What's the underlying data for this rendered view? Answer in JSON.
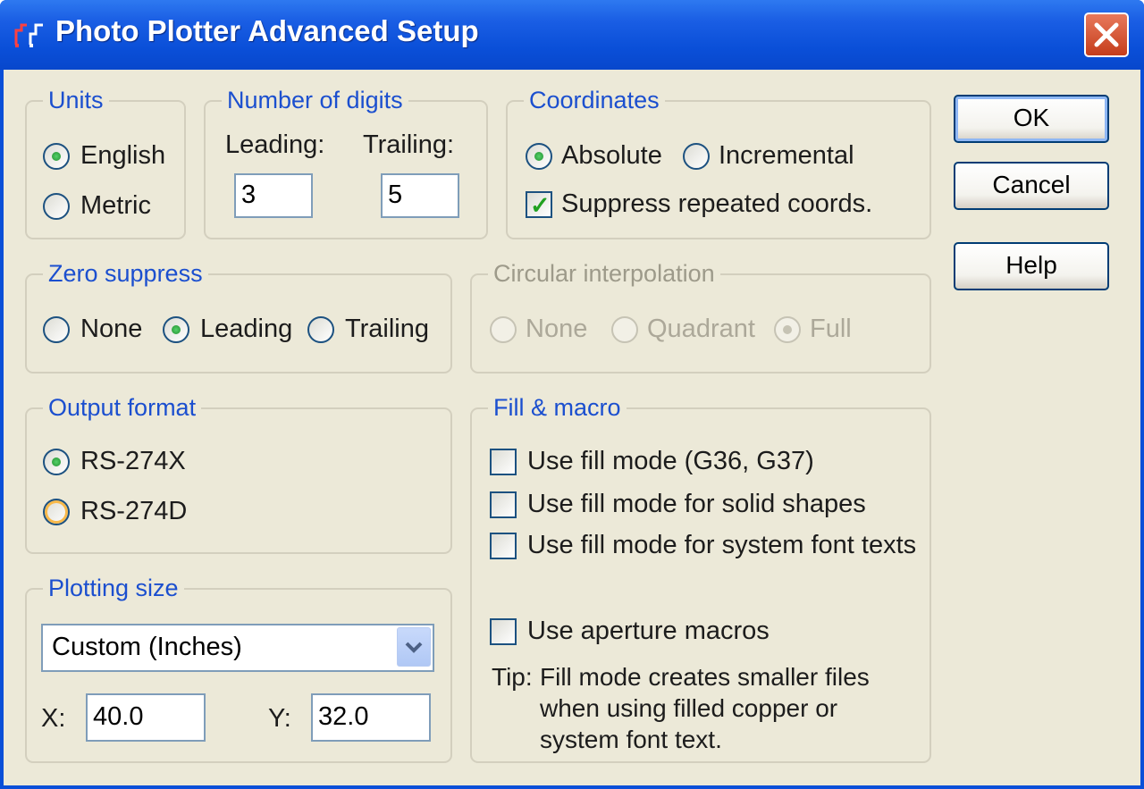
{
  "window": {
    "title": "Photo Plotter Advanced Setup"
  },
  "units": {
    "legend": "Units",
    "english": "English",
    "metric": "Metric",
    "selected": "English"
  },
  "digits": {
    "legend": "Number of digits",
    "leading_label": "Leading:",
    "trailing_label": "Trailing:",
    "leading_value": "3",
    "trailing_value": "5"
  },
  "coordinates": {
    "legend": "Coordinates",
    "absolute": "Absolute",
    "incremental": "Incremental",
    "selected": "Absolute",
    "suppress_label": "Suppress repeated coords.",
    "suppress_checked": true
  },
  "zero_suppress": {
    "legend": "Zero suppress",
    "none": "None",
    "leading": "Leading",
    "trailing": "Trailing",
    "selected": "Leading"
  },
  "circular": {
    "legend": "Circular interpolation",
    "none": "None",
    "quadrant": "Quadrant",
    "full": "Full",
    "selected": "Full",
    "enabled": false
  },
  "output_format": {
    "legend": "Output format",
    "rs274x": "RS-274X",
    "rs274d": "RS-274D",
    "selected": "RS-274X"
  },
  "fill_macro": {
    "legend": "Fill & macro",
    "use_fill": "Use fill mode (G36, G37)",
    "fill_solid": "Use fill mode for solid shapes",
    "fill_text": "Use fill mode for system font texts",
    "aperture": "Use aperture macros",
    "tip_prefix": "Tip:",
    "tip_line1": "Fill mode creates smaller files",
    "tip_line2": "when using filled copper or",
    "tip_line3": "system font text."
  },
  "plotting_size": {
    "legend": "Plotting size",
    "selected": "Custom (Inches)",
    "x_label": "X:",
    "y_label": "Y:",
    "x_value": "40.0",
    "y_value": "32.0"
  },
  "buttons": {
    "ok": "OK",
    "cancel": "Cancel",
    "help": "Help"
  },
  "colors": {
    "titlebar": "#0a4fd8",
    "dialog": "#ece9d8",
    "group_legend": "#1b4fcf",
    "close": "#c53d1b"
  },
  "icons": {
    "app": "plotter-icon",
    "close": "close-icon",
    "dropdown": "chevron-down-icon"
  }
}
